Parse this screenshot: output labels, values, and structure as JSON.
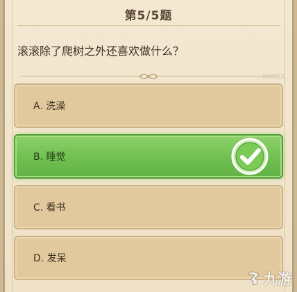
{
  "header": {
    "title": "第5/5题"
  },
  "question": {
    "text": "滚滚除了爬树之外还喜欢做什么？"
  },
  "options": [
    {
      "label": "A. 洗澡",
      "correct": false
    },
    {
      "label": "B. 睡觉",
      "correct": true
    },
    {
      "label": "C. 看书",
      "correct": false
    },
    {
      "label": "D. 发呆",
      "correct": false
    }
  ],
  "watermark": {
    "text": "MXNX"
  },
  "logo": {
    "text": "九游"
  },
  "colors": {
    "panel": "#efe2c7",
    "option": "#e2c99d",
    "correct": "#6dbd4f",
    "title": "#5a4635"
  },
  "icons": {
    "check": "checkmark-icon",
    "logo": "jiuyou-logo-icon"
  }
}
